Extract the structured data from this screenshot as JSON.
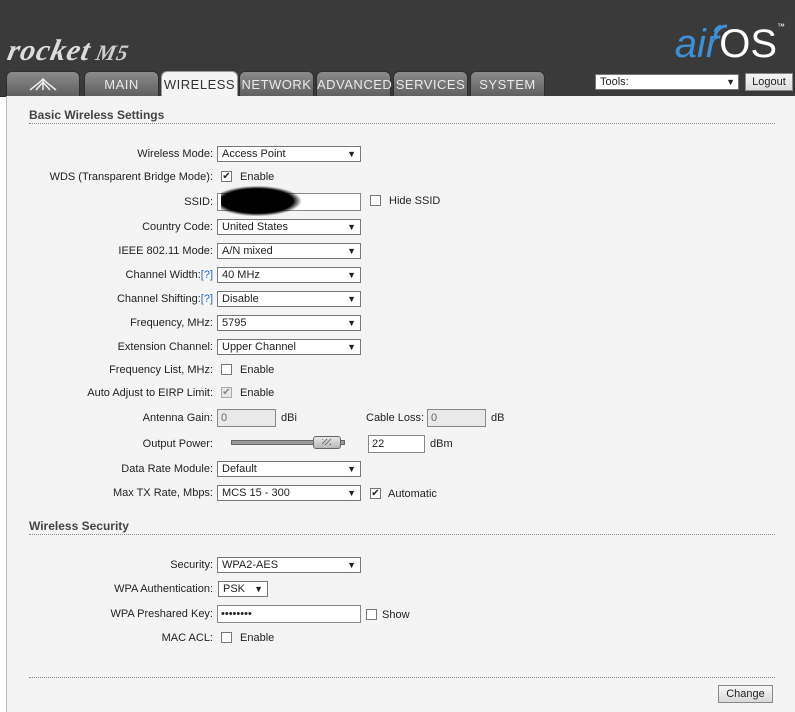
{
  "header": {
    "brand_name": "rocket",
    "brand_model": "M5",
    "airos_air": "air",
    "airos_os": "OS",
    "airos_tm": "™"
  },
  "tabs": [
    {
      "label": "MAIN"
    },
    {
      "label": "WIRELESS"
    },
    {
      "label": "NETWORK"
    },
    {
      "label": "ADVANCED"
    },
    {
      "label": "SERVICES"
    },
    {
      "label": "SYSTEM"
    }
  ],
  "tools": {
    "selected": "Tools:"
  },
  "logout_label": "Logout",
  "basic": {
    "title": "Basic Wireless Settings",
    "wireless_mode": {
      "label": "Wireless Mode:",
      "value": "Access Point"
    },
    "wds": {
      "label": "WDS (Transparent Bridge Mode):",
      "checkbox_label": "Enable",
      "checked": true
    },
    "ssid": {
      "label": "SSID:",
      "value": "",
      "hide_label": "Hide SSID"
    },
    "country": {
      "label": "Country Code:",
      "value": "United States"
    },
    "ieee": {
      "label": "IEEE 802.11 Mode:",
      "value": "A/N mixed"
    },
    "channel_width": {
      "label": "Channel Width:",
      "help": "[?]",
      "value": "40 MHz"
    },
    "channel_shifting": {
      "label": "Channel Shifting:",
      "help": "[?]",
      "value": "Disable"
    },
    "frequency": {
      "label": "Frequency, MHz:",
      "value": "5795"
    },
    "extension": {
      "label": "Extension Channel:",
      "value": "Upper Channel"
    },
    "freq_list": {
      "label": "Frequency List, MHz:",
      "checkbox_label": "Enable",
      "checked": false
    },
    "auto_eirp": {
      "label": "Auto Adjust to EIRP Limit:",
      "checkbox_label": "Enable",
      "checked": true
    },
    "antenna_gain": {
      "label": "Antenna Gain:",
      "value": "0",
      "unit": "dBi"
    },
    "cable_loss": {
      "label": "Cable Loss:",
      "value": "0",
      "unit": "dB"
    },
    "output_power": {
      "label": "Output Power:",
      "value": "22",
      "unit": "dBm"
    },
    "data_rate": {
      "label": "Data Rate Module:",
      "value": "Default"
    },
    "max_tx": {
      "label": "Max TX Rate, Mbps:",
      "value": "MCS 15 - 300",
      "auto_label": "Automatic",
      "auto_checked": true
    }
  },
  "security": {
    "title": "Wireless Security",
    "security": {
      "label": "Security:",
      "value": "WPA2-AES"
    },
    "wpa_auth": {
      "label": "WPA Authentication:",
      "value": "PSK"
    },
    "psk": {
      "label": "WPA Preshared Key:",
      "value": "••••••••",
      "show_label": "Show"
    },
    "mac_acl": {
      "label": "MAC ACL:",
      "checkbox_label": "Enable",
      "checked": false
    }
  },
  "change_label": "Change",
  "icons": {
    "dropdown": "▼",
    "check": "✔"
  }
}
